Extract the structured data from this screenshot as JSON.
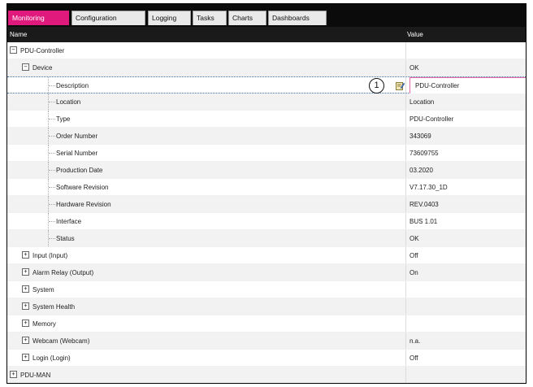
{
  "tabs": [
    {
      "label": "Monitoring",
      "active": true
    },
    {
      "label": "Configuration",
      "active": false
    },
    {
      "label": "Logging",
      "active": false
    },
    {
      "label": "Tasks",
      "active": false
    },
    {
      "label": "Charts",
      "active": false
    },
    {
      "label": "Dashboards",
      "active": false
    }
  ],
  "columns": {
    "name": "Name",
    "value": "Value"
  },
  "callout": "1",
  "accent_color": "#e0197d",
  "rows": [
    {
      "label": "PDU-Controller",
      "value": "",
      "expander": "minus"
    },
    {
      "label": "Device",
      "value": "OK",
      "expander": "minus"
    },
    {
      "label": "Description",
      "value": "PDU-Controller",
      "selected": true
    },
    {
      "label": "Location",
      "value": "Location"
    },
    {
      "label": "Type",
      "value": "PDU-Controller"
    },
    {
      "label": "Order Number",
      "value": "343069"
    },
    {
      "label": "Serial Number",
      "value": "73609755"
    },
    {
      "label": "Production Date",
      "value": "03.2020"
    },
    {
      "label": "Software Revision",
      "value": "V7.17.30_1D"
    },
    {
      "label": "Hardware Revision",
      "value": "REV.0403"
    },
    {
      "label": "Interface",
      "value": "BUS 1.01"
    },
    {
      "label": "Status",
      "value": "OK"
    },
    {
      "label": "Input (Input)",
      "value": "Off",
      "expander": "plus"
    },
    {
      "label": "Alarm Relay (Output)",
      "value": "On",
      "expander": "plus"
    },
    {
      "label": "System",
      "value": "",
      "expander": "plus"
    },
    {
      "label": "System Health",
      "value": "",
      "expander": "plus"
    },
    {
      "label": "Memory",
      "value": "",
      "expander": "plus"
    },
    {
      "label": "Webcam (Webcam)",
      "value": "n.a.",
      "expander": "plus"
    },
    {
      "label": "Login (Login)",
      "value": "Off",
      "expander": "plus"
    },
    {
      "label": "PDU-MAN",
      "value": "",
      "expander": "plus"
    }
  ]
}
